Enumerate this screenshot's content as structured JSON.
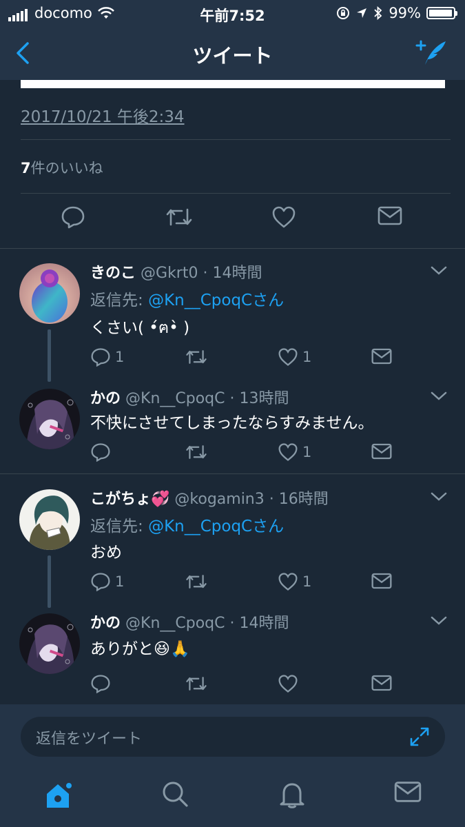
{
  "status_bar": {
    "carrier": "docomo",
    "time": "午前7:52",
    "battery": "99%"
  },
  "nav": {
    "title": "ツイート"
  },
  "detail": {
    "timestamp": "2017/10/21 午後2:34",
    "likes_count": "7",
    "likes_label": "件のいいね"
  },
  "tweets": [
    {
      "name": "きのこ",
      "handle": "@Gkrt0",
      "time": "· 14時間",
      "reply_prefix": "返信先: ",
      "reply_to": "@Kn__CpoqCさん",
      "text": "くさい( •́ฅ•̀ )",
      "reply_count": "1",
      "like_count": "1"
    },
    {
      "name": "かの",
      "handle": "@Kn__CpoqC",
      "time": "· 13時間",
      "text": "不快にさせてしまったならすみません。",
      "reply_count": "",
      "like_count": "1"
    },
    {
      "name": "こがちょ💞",
      "handle": "@kogamin3",
      "time": "· 16時間",
      "reply_prefix": "返信先: ",
      "reply_to": "@Kn__CpoqCさん",
      "text": "おめ",
      "reply_count": "1",
      "like_count": "1"
    },
    {
      "name": "かの",
      "handle": "@Kn__CpoqC",
      "time": "· 14時間",
      "text": "ありがと😆🙏",
      "reply_count": "",
      "like_count": ""
    }
  ],
  "composer": {
    "placeholder": "返信をツイート"
  },
  "colors": {
    "background": "#1b2836",
    "bar": "#243447",
    "accent": "#1da1f2",
    "muted": "#8899a6",
    "divider": "#38444d"
  }
}
